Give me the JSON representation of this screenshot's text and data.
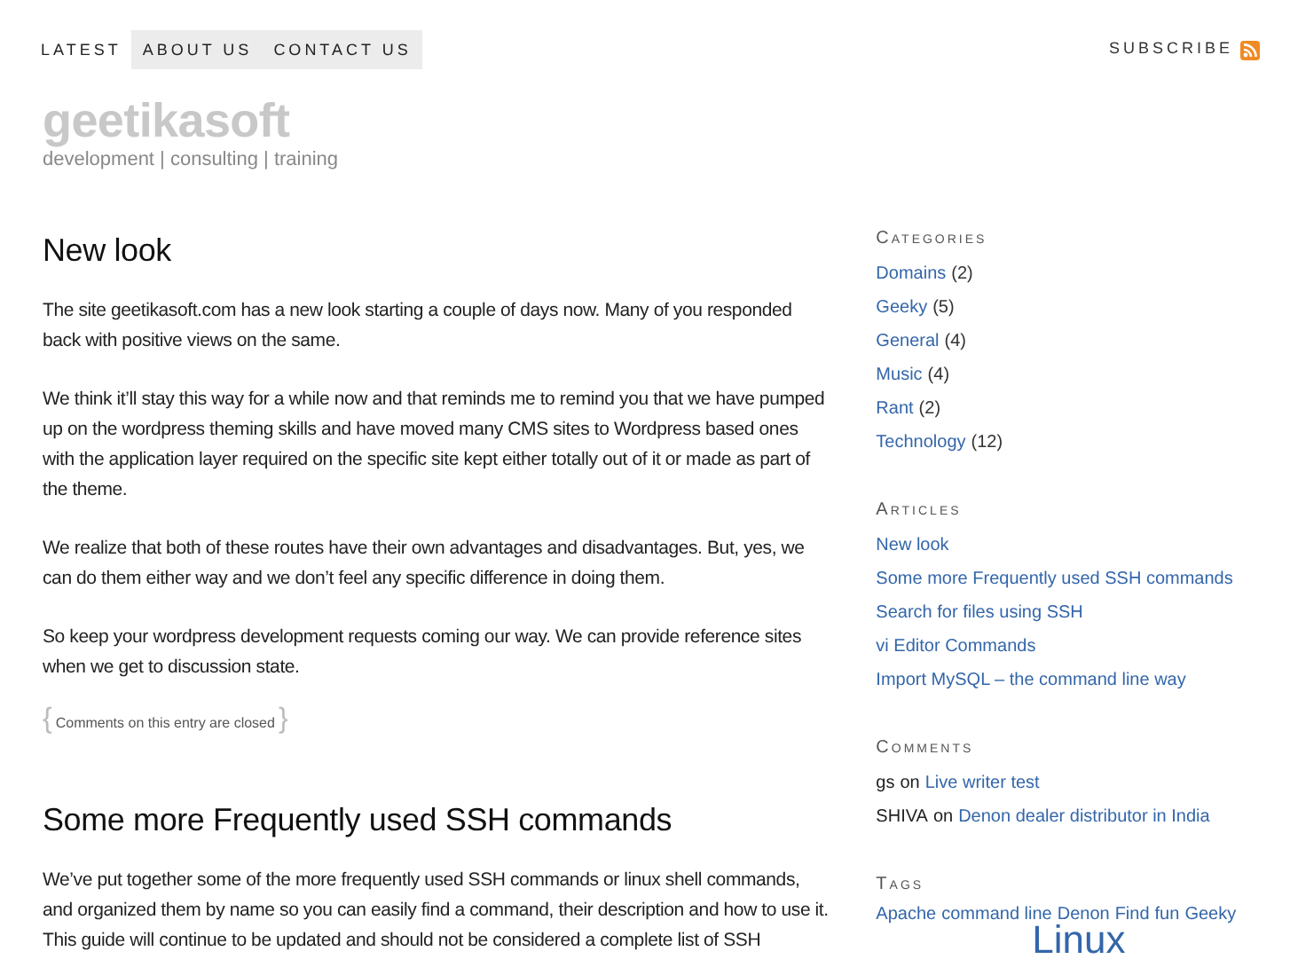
{
  "nav": {
    "items": [
      {
        "label": "LATEST",
        "highlighted": false
      },
      {
        "label": "ABOUT US",
        "highlighted": true
      },
      {
        "label": "CONTACT US",
        "highlighted": true
      }
    ],
    "subscribe": "SUBSCRIBE"
  },
  "header": {
    "title": "geetikasoft",
    "tagline": "development | consulting | training"
  },
  "posts": [
    {
      "title": "New look",
      "paragraphs": [
        "The site geetikasoft.com has a new look starting a couple of days now. Many of you responded back with positive views on the same.",
        "We think it’ll stay this way for a while now and that reminds me to remind you that we have pumped up on the wordpress theming skills and have moved many CMS sites to Wordpress based ones with the application layer required on the specific site kept either totally out of it or made as part of the theme.",
        "We realize that both of these routes have their own advantages and disadvantages. But, yes, we can do them either way and we don’t feel any specific difference in doing them.",
        "So keep your wordpress development requests coming our way. We can provide reference sites when we get to discussion state."
      ],
      "brace_open": "{",
      "meta": "Comments on this entry are closed",
      "brace_close": "}"
    },
    {
      "title": "Some more Frequently used SSH commands",
      "paragraphs": [
        "We’ve put together some of the more frequently used SSH commands or linux shell commands, and organized them by name so you can easily find a command, their description and how to use it. This guide will continue to be updated and should not be considered a complete list of SSH"
      ]
    }
  ],
  "sidebar": {
    "categories": {
      "heading": "Categories",
      "items": [
        {
          "label": "Domains",
          "count": "(2)"
        },
        {
          "label": "Geeky",
          "count": "(5)"
        },
        {
          "label": "General",
          "count": "(4)"
        },
        {
          "label": "Music",
          "count": "(4)"
        },
        {
          "label": "Rant",
          "count": "(2)"
        },
        {
          "label": "Technology",
          "count": "(12)"
        }
      ]
    },
    "articles": {
      "heading": "Articles",
      "items": [
        "New look",
        "Some more Frequently used SSH commands",
        "Search for files using SSH",
        "vi Editor Commands",
        "Import MySQL – the command line way"
      ]
    },
    "comments": {
      "heading": "Comments",
      "items": [
        {
          "author": "gs",
          "joiner": "on",
          "post": "Live writer test"
        },
        {
          "author": "SHIVA",
          "joiner": "on",
          "post": "Denon dealer distributor in India"
        }
      ]
    },
    "tags": {
      "heading": "Tags",
      "items": [
        {
          "label": "Apache",
          "kind": "normal"
        },
        {
          "label": "command line",
          "kind": "normal"
        },
        {
          "label": "Denon",
          "kind": "normal"
        },
        {
          "label": "Find",
          "kind": "normal"
        },
        {
          "label": "fun",
          "kind": "normal"
        },
        {
          "label": "Geeky",
          "kind": "normal"
        },
        {
          "label": "Linux",
          "kind": "large"
        }
      ]
    }
  }
}
